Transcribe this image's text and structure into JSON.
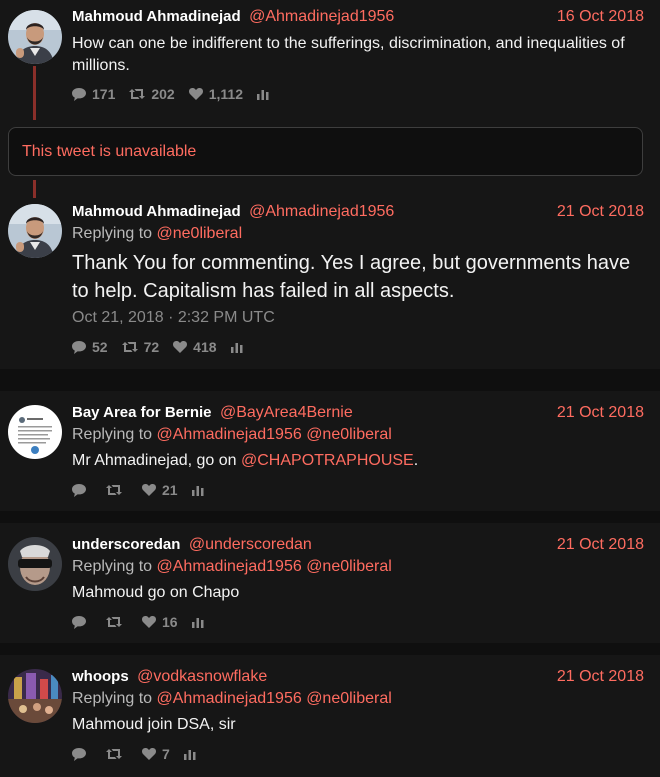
{
  "unavailable_text": "This tweet is unavailable",
  "main_thread": [
    {
      "fullname": "Mahmoud Ahmadinejad",
      "username": "@Ahmadinejad1956",
      "date": "16 Oct 2018",
      "content": "How can one be indifferent to the sufferings, discrimination, and inequalities of millions.",
      "replies": "171",
      "retweets": "202",
      "likes": "1,112"
    },
    {
      "fullname": "Mahmoud Ahmadinejad",
      "username": "@Ahmadinejad1956",
      "date": "21 Oct 2018",
      "replying_label": "Replying to",
      "replying_to": "@ne0liberal",
      "content": "Thank You for commenting. Yes I agree, but governments have to help. Capitalism has failed in all aspects.",
      "published": "Oct 21, 2018 · 2:32 PM UTC",
      "replies": "52",
      "retweets": "72",
      "likes": "418"
    }
  ],
  "replies": [
    {
      "fullname": "Bay Area for Bernie",
      "username": "@BayArea4Bernie",
      "date": "21 Oct 2018",
      "replying_label": "Replying to",
      "replying_to": [
        "@Ahmadinejad1956",
        "@ne0liberal"
      ],
      "content_prefix": "Mr Ahmadinejad, go on ",
      "content_link": "@CHAPOTRAPHOUSE",
      "content_suffix": ".",
      "likes": "21"
    },
    {
      "fullname": "underscoredan",
      "username": "@underscoredan",
      "date": "21 Oct 2018",
      "replying_label": "Replying to",
      "replying_to": [
        "@Ahmadinejad1956",
        "@ne0liberal"
      ],
      "content": "Mahmoud go on Chapo",
      "likes": "16"
    },
    {
      "fullname": "whoops",
      "username": "@vodkasnowflake",
      "date": "21 Oct 2018",
      "replying_label": "Replying to",
      "replying_to": [
        "@Ahmadinejad1956",
        "@ne0liberal"
      ],
      "content": "Mahmoud join DSA, sir",
      "likes": "7"
    }
  ],
  "colors": {
    "background": "#0f0f0f",
    "panel": "#161616",
    "accent": "#ff6c60",
    "thread_line": "#8a2f2a",
    "muted": "#8a8a8a"
  },
  "icons": [
    "comment-icon",
    "retweet-icon",
    "heart-icon",
    "bar-chart-icon"
  ]
}
